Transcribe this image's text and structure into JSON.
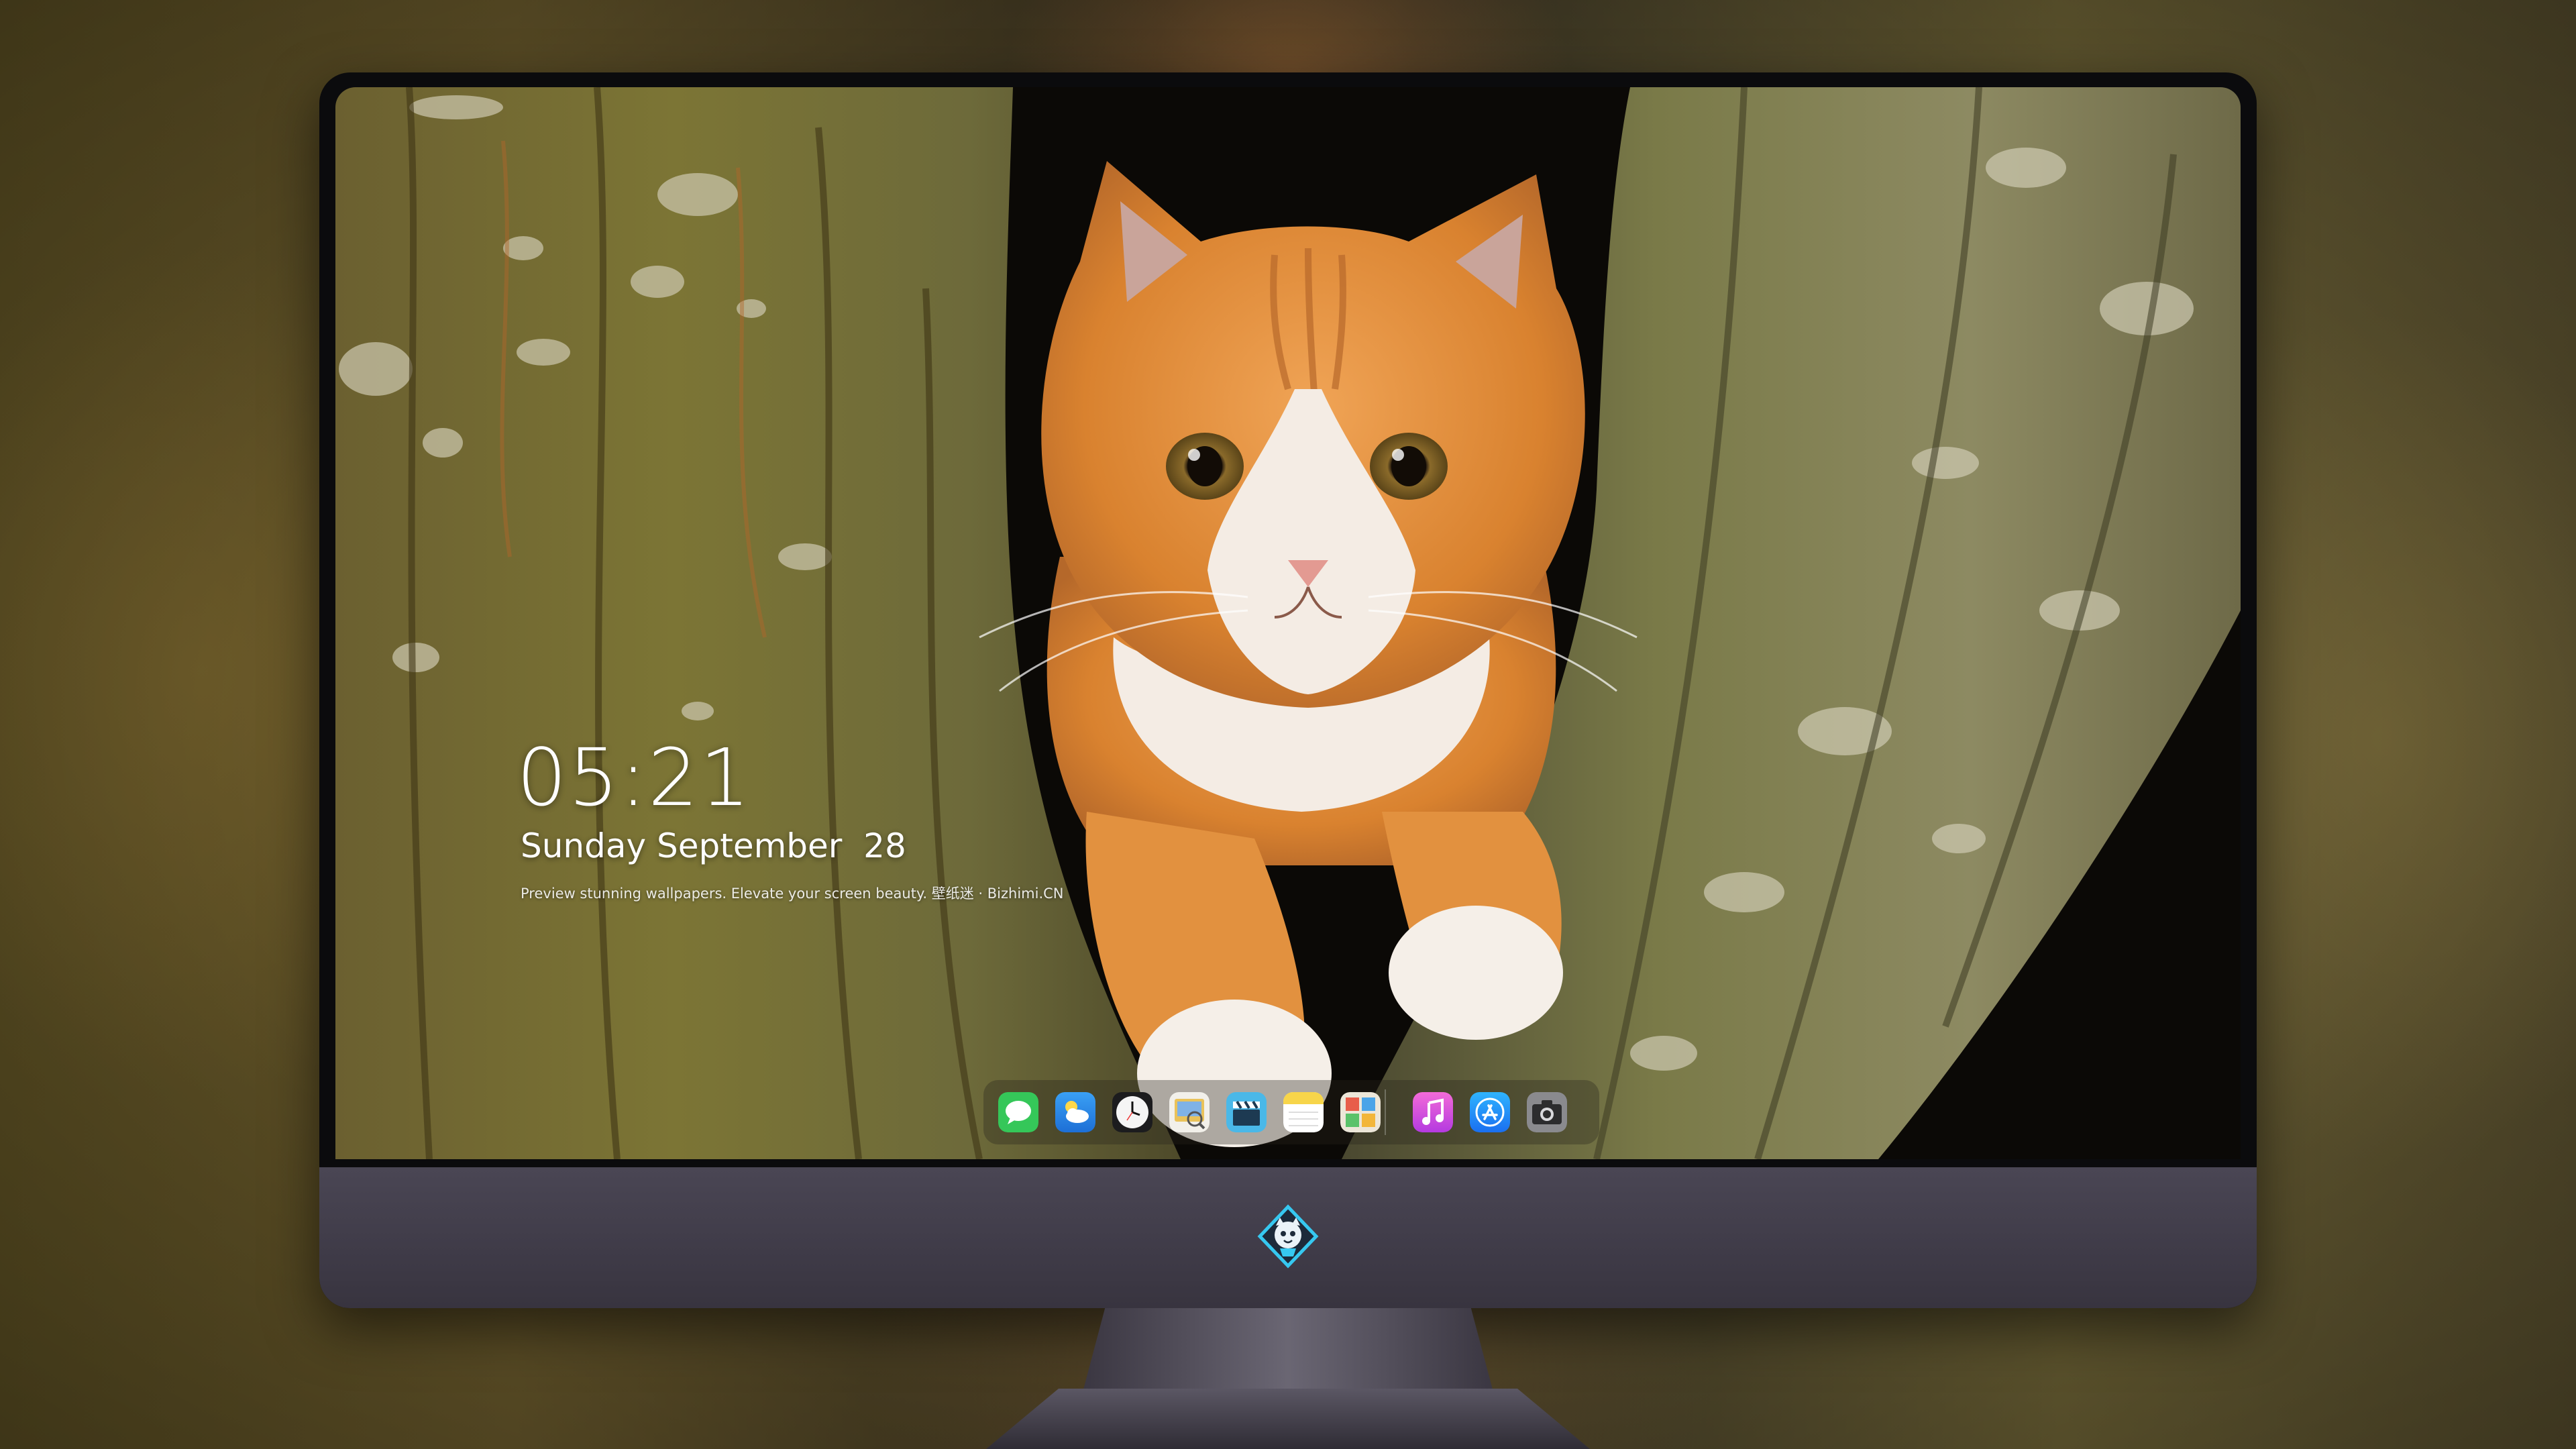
{
  "lock_screen": {
    "time": "05:21",
    "date": "Sunday September  28",
    "caption": "Preview stunning wallpapers. Elevate your screen beauty. 壁纸迷 · Bizhimi.CN"
  },
  "wallpaper": {
    "subject": "orange-white kitten in tree fork",
    "palette": {
      "bark": "#6b6a3a",
      "moss": "#7a7a2e",
      "fur_orange": "#e3913e",
      "fur_white": "#f4ece4",
      "background_dark": "#0a0806"
    }
  },
  "dock": {
    "apps": [
      {
        "name": "Messages",
        "icon": "messages-icon",
        "color": "#35c759"
      },
      {
        "name": "Weather",
        "icon": "weather-icon",
        "color": "#2f8cf0"
      },
      {
        "name": "Clock",
        "icon": "clock-icon",
        "color": "#f2f2f2"
      },
      {
        "name": "Preview",
        "icon": "preview-icon",
        "color": "#e9c25a"
      },
      {
        "name": "Clips",
        "icon": "clapperboard-icon",
        "color": "#4ab8e8"
      },
      {
        "name": "Notes",
        "icon": "notes-icon",
        "color": "#f7d54a"
      },
      {
        "name": "Photo Booth",
        "icon": "photo-grid-icon",
        "color": "#e8e0d0"
      },
      {
        "name": "Music",
        "icon": "music-icon",
        "color": "#d956e0"
      },
      {
        "name": "App Store",
        "icon": "app-store-icon",
        "color": "#1e88f0"
      },
      {
        "name": "Camera",
        "icon": "camera-icon",
        "color": "#8a8a8e"
      }
    ]
  },
  "chin_logo": {
    "icon": "mascot-logo-icon",
    "color": "#36c8f0"
  }
}
